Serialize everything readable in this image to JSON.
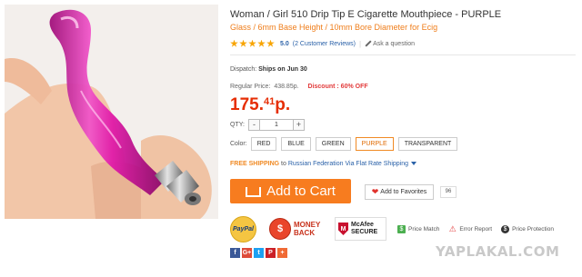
{
  "product": {
    "title": "Woman / Girl 510 Drip Tip E Cigarette Mouthpiece  -  PURPLE",
    "subtitle": "Glass / 6mm Base Height / 10mm Bore Diameter for Ecig",
    "rating_score": "5.0",
    "rating_value": 5,
    "reviews": "(2 Customer Reviews)",
    "ask": "Ask a question"
  },
  "dispatch": {
    "label": "Dispatch:",
    "value": "Ships on Jun 30"
  },
  "pricing": {
    "regular_label": "Regular Price:",
    "regular_value": "438.85p.",
    "discount": "Discount : 60% OFF",
    "price_main": "175.",
    "price_cents": "41",
    "price_currency": "p."
  },
  "quantity": {
    "label": "QTY:",
    "minus": "-",
    "value": "1",
    "plus": "+"
  },
  "colors": {
    "label": "Color:",
    "options": [
      "RED",
      "BLUE",
      "GREEN",
      "PURPLE",
      "TRANSPARENT"
    ],
    "selected": "PURPLE"
  },
  "shipping": {
    "free": "FREE SHIPPING",
    "to": "to",
    "destination": "Russian Federation Via Flat Rate Shipping"
  },
  "actions": {
    "add_to_cart": "Add to Cart",
    "add_to_favorites": "Add to Favorites",
    "favorites_count": "96"
  },
  "badges": {
    "paypal": "PayPal",
    "money_back_line1": "MONEY",
    "money_back_line2": "BACK",
    "mcafee_line1": "McAfee",
    "mcafee_line2": "SECURE",
    "price_match": "Price Match",
    "error_report": "Error Report",
    "price_protection": "Price Protection"
  },
  "social": [
    "f",
    "G+",
    "t",
    "P",
    "+"
  ],
  "watermark": "YAPLAKAL.COM",
  "colors_palette": {
    "accent_orange": "#f77c1f",
    "price_red": "#e62e04",
    "link_blue": "#2a61a8",
    "product_pink": "#e01aa8"
  }
}
